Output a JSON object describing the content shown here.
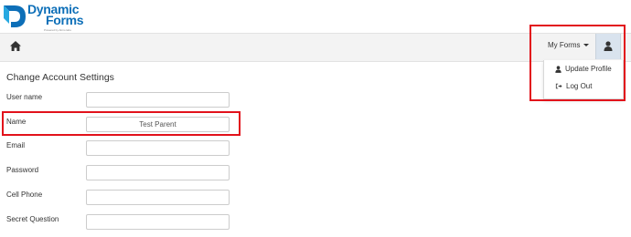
{
  "brand": {
    "line1": "Dynamic",
    "line2": "Forms",
    "tagline": "Powered by Abrio labs",
    "accent": "#0d6fb8"
  },
  "navbar": {
    "home_icon": "home-icon",
    "my_forms_label": "My Forms",
    "user_icon": "user-icon"
  },
  "dropdown": {
    "items": [
      {
        "label": "Update Profile",
        "icon": "user-icon"
      },
      {
        "label": "Log Out",
        "icon": "logout-icon"
      }
    ]
  },
  "page": {
    "title": "Change Account Settings",
    "fields": [
      {
        "label": "User name",
        "value": ""
      },
      {
        "label": "Name",
        "value": "Test Parent"
      },
      {
        "label": "Email",
        "value": ""
      },
      {
        "label": "Password",
        "value": ""
      },
      {
        "label": "Cell Phone",
        "value": ""
      },
      {
        "label": "Secret Question",
        "value": ""
      }
    ]
  },
  "highlight_color": "#e2121b"
}
